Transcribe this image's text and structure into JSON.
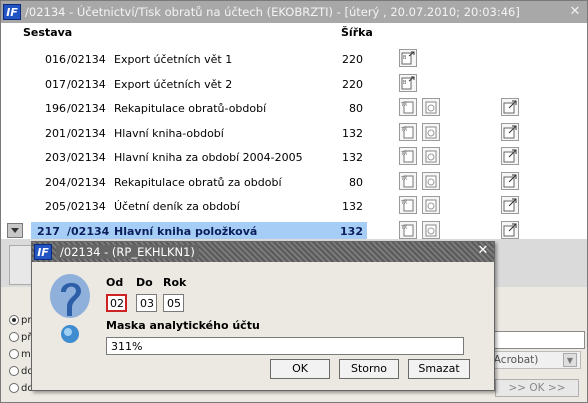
{
  "window": {
    "title": "/02134 - Účetnictví/Tisk obratů na účtech (EKOBRZTI) - [úterý , 20.07.2010; 20:03:46]",
    "close_glyph": "✕"
  },
  "table": {
    "header_sestava": "Sestava",
    "header_sirka": "Šířka",
    "rows": [
      {
        "num": "016",
        "code": "/02134",
        "name": "Export účetních vět 1",
        "width": "220",
        "icons": [
          "export-icon"
        ]
      },
      {
        "num": "017",
        "code": "/02134",
        "name": "Export účetních vět 2",
        "width": "220",
        "icons": [
          "export-icon"
        ]
      },
      {
        "num": "196",
        "code": "/02134",
        "name": "Rekapitulace obratů-období",
        "width": "80",
        "icons": [
          "text-output-icon",
          "print-preview-icon",
          "external-output-icon"
        ]
      },
      {
        "num": "201",
        "code": "/02134",
        "name": "Hlavní kniha-období",
        "width": "132",
        "icons": [
          "text-output-icon",
          "print-preview-icon",
          "external-output-icon"
        ]
      },
      {
        "num": "203",
        "code": "/02134",
        "name": "Hlavní kniha za období 2004-2005",
        "width": "132",
        "icons": [
          "text-output-icon",
          "print-preview-icon",
          "external-output-icon"
        ]
      },
      {
        "num": "204",
        "code": "/02134",
        "name": "Rekapitulace obratů za období",
        "width": "80",
        "icons": [
          "text-output-icon",
          "print-preview-icon",
          "external-output-icon"
        ]
      },
      {
        "num": "205",
        "code": "/02134",
        "name": "Účetní deník za období",
        "width": "132",
        "icons": [
          "text-output-icon",
          "print-preview-icon",
          "external-output-icon"
        ]
      },
      {
        "num": "217",
        "code": "/02134",
        "name": "Hlavní kniha položková",
        "width": "132",
        "icons": [
          "text-output-icon",
          "print-preview-icon",
          "external-output-icon"
        ],
        "selected": true
      }
    ]
  },
  "background": {
    "radio_labels": [
      "pr",
      "př",
      "m",
      "do",
      "do"
    ],
    "radio_selected": 0,
    "combo_text": "e Acrobat)",
    "ok_button": ">> OK >>"
  },
  "dialog": {
    "title": "/02134 - (RP_EKHLKN1)",
    "close_glyph": "✕",
    "label_od": "Od",
    "label_do": "Do",
    "label_rok": "Rok",
    "value_od": "02",
    "value_do": "03",
    "value_rok": "05",
    "label_maska": "Maska analytického účtu",
    "value_maska": "311%",
    "btn_ok": "OK",
    "btn_storno": "Storno",
    "btn_smazat": "Smazat"
  },
  "colors": {
    "selection": "#a6cdf5",
    "active_field_border": "#cc2222",
    "app_icon": "#2254c4"
  }
}
